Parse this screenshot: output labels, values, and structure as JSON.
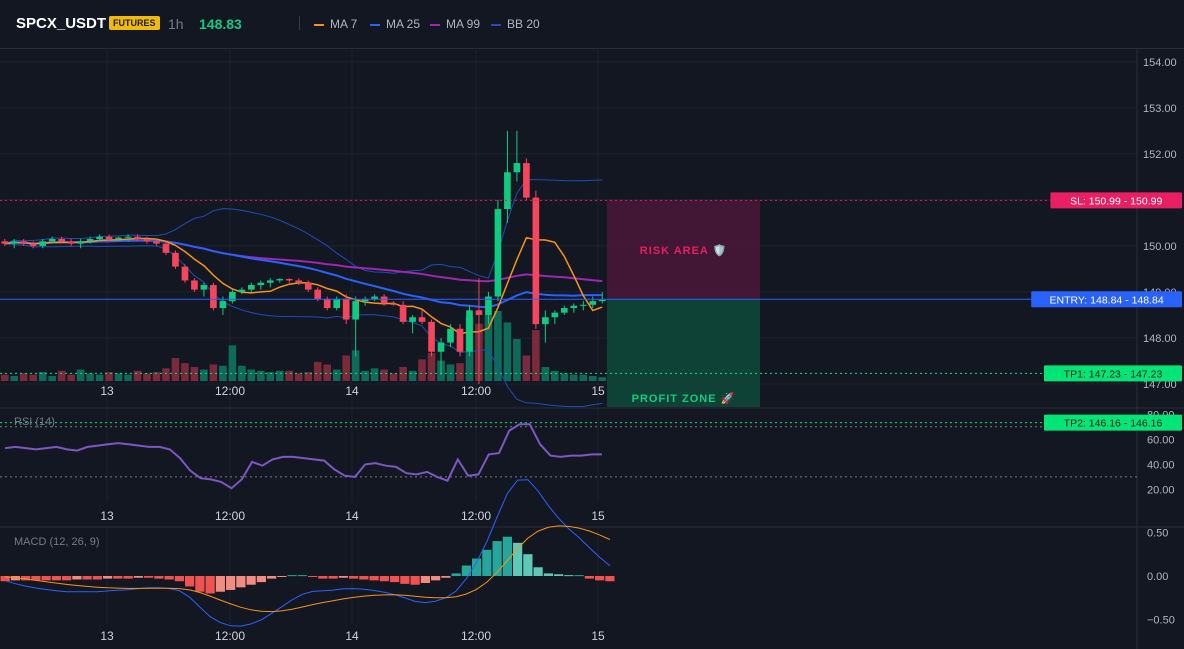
{
  "header": {
    "symbol": "SPCX_USDT",
    "badge": "FUTURES",
    "timeframe": "1h",
    "price": "148.83",
    "legend": [
      {
        "label": "MA 7",
        "color": "#f7931a"
      },
      {
        "label": "MA 25",
        "color": "#2962ff"
      },
      {
        "label": "MA 99",
        "color": "#9c27b0"
      },
      {
        "label": "BB 20",
        "color": "#1e4db7"
      }
    ]
  },
  "colors": {
    "up": "#0ecb81",
    "down": "#f6465d",
    "background": "#131722"
  },
  "x_axis": {
    "ticks": [
      "13",
      "12:00",
      "14",
      "12:00",
      "15"
    ]
  },
  "main_pane": {
    "y_ticks": [
      "154.00",
      "153.00",
      "152.00",
      "151.00",
      "150.00",
      "149.00",
      "148.00",
      "147.00"
    ],
    "levels": [
      {
        "label": "SL: 150.99 - 150.99",
        "value": 150.99,
        "color": "#e91e63",
        "style": "dotted"
      },
      {
        "label": "ENTRY: 148.84 - 148.84",
        "value": 148.84,
        "color": "#2962ff",
        "style": "solid"
      },
      {
        "label": "TP1: 147.23 - 147.23",
        "value": 147.23,
        "color": "#00e676",
        "style": "dotted"
      },
      {
        "label": "TP2: 146.16 - 146.16",
        "value": 146.16,
        "color": "#00e676",
        "style": "dotted"
      }
    ],
    "risk_zone": {
      "label": "RISK AREA 🛡️"
    },
    "profit_zone": {
      "label": "PROFIT ZONE 🚀"
    }
  },
  "rsi_pane": {
    "label": "RSI (14)",
    "y_ticks": [
      "80.00",
      "60.00",
      "40.00",
      "20.00"
    ],
    "overbought": 70,
    "oversold": 30
  },
  "macd_pane": {
    "label": "MACD (12, 26, 9)",
    "y_ticks": [
      "0.50",
      "0.00",
      "−0.50"
    ]
  },
  "chart_data": {
    "type": "candlestick",
    "x_ticks": [
      "13",
      "12:00",
      "14",
      "12:00",
      "15"
    ],
    "candles": [
      [
        150.1,
        150.15,
        150.0,
        150.05
      ],
      [
        150.05,
        150.15,
        149.95,
        150.1
      ],
      [
        150.1,
        150.15,
        150.0,
        150.05
      ],
      [
        150.05,
        150.1,
        149.95,
        150.0
      ],
      [
        150.0,
        150.15,
        149.95,
        150.1
      ],
      [
        150.1,
        150.2,
        150.05,
        150.15
      ],
      [
        150.15,
        150.2,
        150.05,
        150.1
      ],
      [
        150.1,
        150.15,
        150.0,
        150.05
      ],
      [
        150.05,
        150.15,
        149.95,
        150.1
      ],
      [
        150.1,
        150.2,
        150.05,
        150.15
      ],
      [
        150.15,
        150.25,
        150.1,
        150.2
      ],
      [
        150.2,
        150.25,
        150.1,
        150.15
      ],
      [
        150.15,
        150.2,
        150.1,
        150.18
      ],
      [
        150.18,
        150.25,
        150.1,
        150.2
      ],
      [
        150.2,
        150.25,
        150.1,
        150.15
      ],
      [
        150.15,
        150.2,
        150.05,
        150.1
      ],
      [
        150.1,
        150.15,
        150.0,
        150.05
      ],
      [
        150.05,
        150.1,
        149.8,
        149.85
      ],
      [
        149.85,
        149.9,
        149.5,
        149.55
      ],
      [
        149.55,
        149.6,
        149.2,
        149.25
      ],
      [
        149.25,
        149.3,
        149.0,
        149.05
      ],
      [
        149.05,
        149.2,
        148.9,
        149.15
      ],
      [
        149.15,
        149.2,
        148.6,
        148.65
      ],
      [
        148.65,
        148.9,
        148.5,
        148.8
      ],
      [
        148.8,
        149.05,
        148.75,
        149.0
      ],
      [
        149.0,
        149.1,
        148.95,
        149.05
      ],
      [
        149.05,
        149.2,
        149.0,
        149.15
      ],
      [
        149.15,
        149.25,
        149.05,
        149.2
      ],
      [
        149.2,
        149.3,
        149.1,
        149.25
      ],
      [
        149.25,
        149.3,
        149.2,
        149.28
      ],
      [
        149.28,
        149.3,
        149.2,
        149.25
      ],
      [
        149.25,
        149.3,
        149.15,
        149.2
      ],
      [
        149.2,
        149.25,
        149.0,
        149.05
      ],
      [
        149.05,
        149.1,
        148.8,
        148.85
      ],
      [
        148.85,
        148.9,
        148.6,
        148.65
      ],
      [
        148.65,
        148.9,
        148.6,
        148.85
      ],
      [
        148.85,
        148.95,
        148.3,
        148.4
      ],
      [
        148.4,
        148.9,
        147.6,
        148.8
      ],
      [
        148.8,
        148.9,
        148.7,
        148.85
      ],
      [
        148.85,
        148.95,
        148.8,
        148.9
      ],
      [
        148.9,
        148.95,
        148.7,
        148.75
      ],
      [
        148.75,
        148.8,
        148.7,
        148.72
      ],
      [
        148.72,
        148.8,
        148.3,
        148.35
      ],
      [
        148.35,
        148.5,
        148.1,
        148.45
      ],
      [
        148.45,
        148.6,
        148.3,
        148.35
      ],
      [
        148.35,
        148.4,
        147.6,
        147.7
      ],
      [
        147.7,
        148.0,
        147.2,
        147.9
      ],
      [
        147.9,
        148.3,
        147.8,
        148.2
      ],
      [
        148.2,
        148.3,
        147.6,
        147.7
      ],
      [
        147.7,
        148.7,
        147.6,
        148.6
      ],
      [
        148.6,
        149.3,
        147.0,
        148.5
      ],
      [
        148.5,
        149.0,
        148.3,
        148.9
      ],
      [
        148.9,
        151.0,
        148.8,
        150.8
      ],
      [
        150.8,
        152.5,
        150.5,
        151.6
      ],
      [
        151.6,
        152.5,
        151.4,
        151.8
      ],
      [
        151.8,
        151.9,
        151.0,
        151.05
      ],
      [
        151.05,
        151.2,
        148.2,
        148.3
      ],
      [
        148.3,
        148.6,
        147.9,
        148.45
      ],
      [
        148.45,
        148.6,
        148.3,
        148.55
      ],
      [
        148.55,
        148.7,
        148.5,
        148.65
      ],
      [
        148.65,
        148.75,
        148.55,
        148.7
      ],
      [
        148.7,
        148.8,
        148.6,
        148.72
      ],
      [
        148.72,
        148.9,
        148.65,
        148.8
      ],
      [
        148.8,
        149.0,
        148.75,
        148.83
      ]
    ],
    "volume": [
      0.5,
      0.4,
      0.6,
      0.5,
      0.7,
      0.4,
      0.8,
      0.5,
      0.9,
      0.6,
      0.5,
      0.7,
      0.6,
      0.5,
      0.8,
      0.6,
      0.7,
      1.0,
      1.8,
      1.4,
      1.1,
      0.9,
      1.3,
      1.2,
      2.8,
      1.2,
      0.9,
      0.8,
      0.7,
      0.8,
      0.8,
      0.6,
      0.7,
      1.5,
      1.3,
      0.9,
      2.0,
      2.4,
      0.8,
      1.0,
      0.9,
      0.6,
      1.1,
      0.8,
      1.7,
      2.2,
      1.6,
      1.3,
      1.4,
      5.0,
      4.5,
      5.2,
      5.5,
      4.6,
      3.3,
      2.0,
      4.0,
      1.1,
      0.8,
      0.6,
      0.5,
      0.5,
      0.4,
      0.3
    ],
    "rsi": [
      53,
      54,
      53,
      52,
      53,
      54,
      52,
      51,
      54,
      55,
      56,
      57,
      56,
      55,
      54,
      54,
      52,
      45,
      35,
      29,
      28,
      26,
      21,
      28,
      42,
      39,
      44,
      46,
      46,
      45,
      44,
      43,
      36,
      31,
      30,
      40,
      41,
      39,
      38,
      33,
      32,
      34,
      30,
      27,
      44,
      31,
      32,
      48,
      49,
      67,
      72,
      72,
      56,
      47,
      46,
      47,
      47,
      48,
      48
    ],
    "macd_hist": [
      -0.06,
      -0.05,
      -0.05,
      -0.05,
      -0.05,
      -0.05,
      -0.05,
      -0.04,
      -0.04,
      -0.04,
      -0.03,
      -0.03,
      -0.03,
      -0.02,
      -0.02,
      -0.03,
      -0.04,
      -0.06,
      -0.12,
      -0.18,
      -0.2,
      -0.18,
      -0.16,
      -0.13,
      -0.1,
      -0.07,
      -0.03,
      -0.01,
      0.01,
      0.01,
      -0.01,
      -0.03,
      -0.03,
      -0.02,
      -0.03,
      -0.04,
      -0.05,
      -0.06,
      -0.07,
      -0.09,
      -0.1,
      -0.08,
      -0.05,
      -0.02,
      0.03,
      0.12,
      0.2,
      0.3,
      0.4,
      0.45,
      0.38,
      0.25,
      0.1,
      0.03,
      0.02,
      0.01,
      0.01,
      -0.03,
      -0.05,
      -0.06
    ],
    "macd_ylim": [
      -0.55,
      0.55
    ],
    "rsi_ylim": [
      10,
      85
    ],
    "price_ylim": [
      146.5,
      154.3
    ]
  }
}
